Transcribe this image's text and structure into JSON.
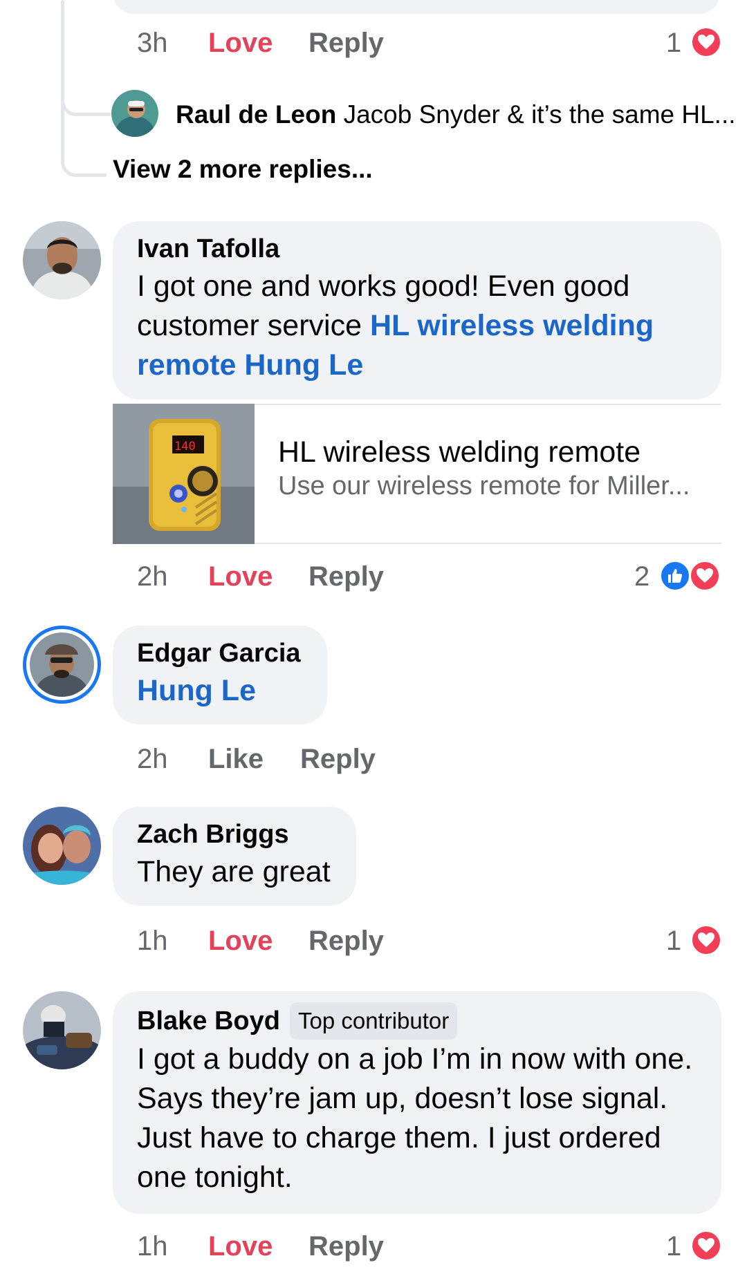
{
  "previous_comment": {
    "time": "3h",
    "reaction_label": "Love",
    "reply_label": "Reply",
    "reaction_count": "1"
  },
  "nested_reply": {
    "author": "Raul de Leon",
    "preview": "Jacob Snyder & it’s the same HL..."
  },
  "view_more_label": "View 2 more replies...",
  "comments": [
    {
      "author": "Ivan Tafolla",
      "text": "I got one and works good! Even good customer service ",
      "mentions": "HL wireless welding remote Hung Le",
      "link_card": {
        "title": "HL wireless welding remote",
        "description": "Use our wireless remote for Miller...",
        "thumb_display": "140"
      },
      "time": "2h",
      "reaction_label": "Love",
      "reply_label": "Reply",
      "reaction_count": "2",
      "reactions": [
        "like-icon",
        "heart-icon"
      ]
    },
    {
      "author": "Edgar Garcia",
      "mentions": "Hung Le",
      "time": "2h",
      "reaction_label": "Like",
      "reply_label": "Reply"
    },
    {
      "author": "Zach Briggs",
      "text": "They are great",
      "time": "1h",
      "reaction_label": "Love",
      "reply_label": "Reply",
      "reaction_count": "1"
    },
    {
      "author": "Blake Boyd",
      "badge": "Top contributor",
      "text": "I got a buddy on a job I’m in now with one. Says they’re jam up, doesn’t lose signal. Just have to charge them.  I just ordered one tonight.",
      "time": "1h",
      "reaction_label": "Love",
      "reply_label": "Reply",
      "reaction_count": "1"
    }
  ],
  "colors": {
    "bubble": "#f0f2f5",
    "love": "#e4415a",
    "link": "#1b67c9",
    "meta": "#65676b",
    "thread_line": "#e4e6eb"
  }
}
